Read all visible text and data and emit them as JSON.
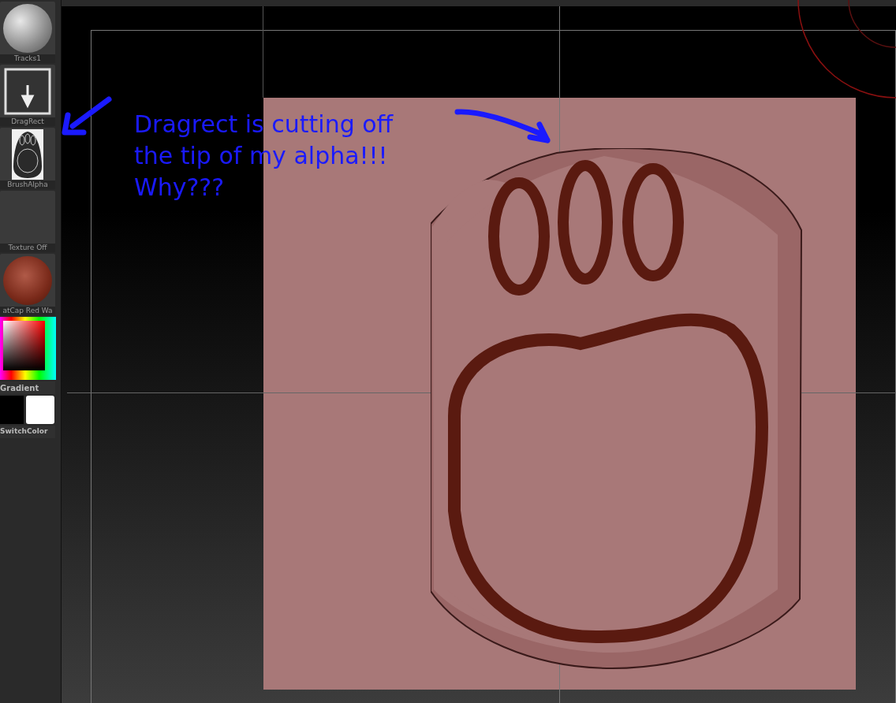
{
  "sidebar": {
    "items": [
      {
        "kind": "sphere",
        "label": "Tracks1"
      },
      {
        "kind": "stroke",
        "label": "DragRect"
      },
      {
        "kind": "alpha",
        "label": "BrushAlpha"
      },
      {
        "kind": "empty",
        "label": "Texture Off"
      },
      {
        "kind": "material",
        "label": "atCap Red Wa"
      }
    ],
    "color_picker": {
      "label": "Gradient"
    },
    "swatches": {
      "label": "SwitchColor"
    }
  },
  "annotation": {
    "lines": [
      "Dragrect is cutting off",
      "the tip of my alpha!!!",
      "Why???"
    ]
  }
}
